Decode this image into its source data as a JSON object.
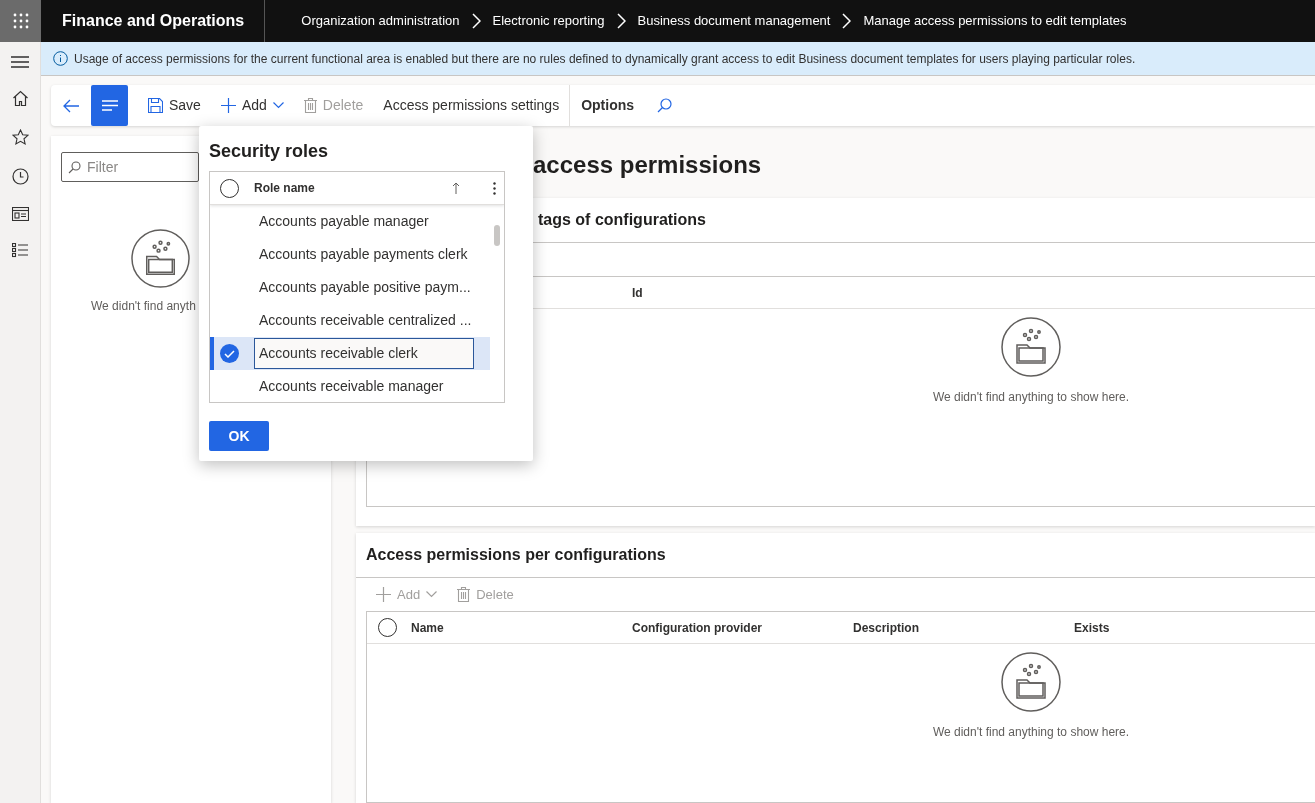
{
  "top_bar": {
    "app_title": "Finance and Operations",
    "breadcrumbs": [
      "Organization administration",
      "Electronic reporting",
      "Business document management",
      "Manage access permissions to edit templates"
    ]
  },
  "info_bar": {
    "message": "Usage of access permissions for the current functional area is enabled but there are no rules defined to dynamically grant access to edit Business document templates for users playing particular roles."
  },
  "action_pane": {
    "buttons": [
      {
        "kind": "save",
        "label": "Save",
        "disabled": false
      },
      {
        "kind": "add",
        "label": "Add",
        "disabled": false
      },
      {
        "kind": "delete",
        "label": "Delete",
        "disabled": true
      },
      {
        "kind": "text",
        "label": "Access permissions settings",
        "disabled": false
      },
      {
        "kind": "tab",
        "label": "Options",
        "disabled": false
      }
    ]
  },
  "filter_pane": {
    "filter": {
      "placeholder": "Filter"
    },
    "empty_message": "We didn't find anyth"
  },
  "page": {
    "title": "access permissions",
    "sections": [
      {
        "title": "tags of configurations",
        "columns": [
          "Id"
        ],
        "empty_message": "We didn't find anything to show here."
      },
      {
        "title": "Access permissions per configurations",
        "toolbar": [
          {
            "kind": "add",
            "label": "Add",
            "disabled": true
          },
          {
            "kind": "delete",
            "label": "Delete",
            "disabled": true
          }
        ],
        "select_all": {
          "checked": false
        },
        "columns": [
          "Name",
          "Configuration provider",
          "Description",
          "Exists"
        ],
        "empty_message": "We didn't find anything to show here."
      }
    ]
  },
  "dialog": {
    "title": "Security roles",
    "select_all": {
      "checked": false
    },
    "column": "Role name",
    "rows": [
      {
        "name": "Accounts payable manager",
        "selected": false
      },
      {
        "name": "Accounts payable payments clerk",
        "selected": false
      },
      {
        "name": "Accounts payable positive paym...",
        "selected": false
      },
      {
        "name": "Accounts receivable centralized ...",
        "selected": false
      },
      {
        "name": "Accounts receivable clerk",
        "selected": true
      },
      {
        "name": "Accounts receivable manager",
        "selected": false
      }
    ],
    "ok_button": "OK"
  }
}
